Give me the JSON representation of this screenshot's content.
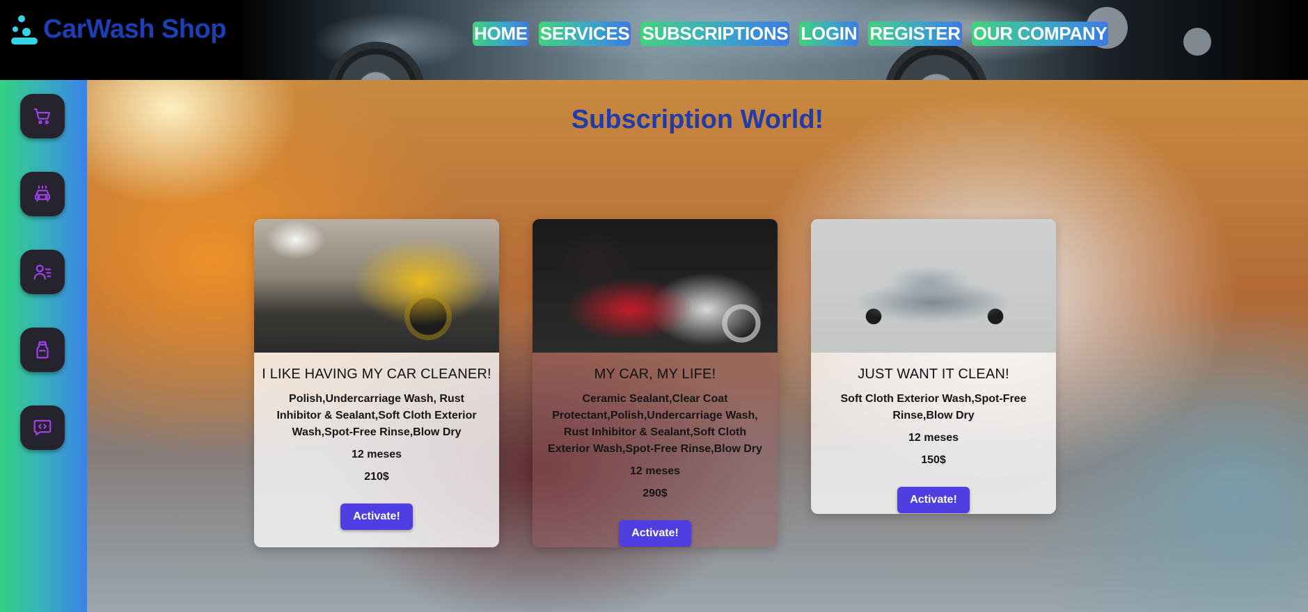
{
  "header": {
    "logo_text": "CarWash Shop",
    "nav": [
      {
        "label": "HOME"
      },
      {
        "label": "SERVICES"
      },
      {
        "label": "SUBSCRIPTIONS"
      },
      {
        "label": "LOGIN"
      },
      {
        "label": "REGISTER"
      },
      {
        "label": "OUR COMPANY"
      }
    ]
  },
  "sidebar": {
    "items": [
      {
        "icon": "cart-icon"
      },
      {
        "icon": "car-wash-icon"
      },
      {
        "icon": "user-list-icon"
      },
      {
        "icon": "spray-bottle-icon"
      },
      {
        "icon": "chat-code-icon"
      }
    ],
    "accent": "#a13fe8"
  },
  "main": {
    "title": "Subscription World!",
    "cards": [
      {
        "image": "yellow-car-wash-image",
        "title": "I LIKE HAVING MY CAR CLEANER!",
        "description": "Polish,Undercarriage Wash, Rust Inhibitor & Sealant,Soft Cloth Exterior Wash,Spot-Free Rinse,Blow Dry",
        "duration": "12 meses",
        "price": "210$",
        "button": "Activate!"
      },
      {
        "image": "red-car-foam-image",
        "title": "MY CAR, MY LIFE!",
        "description": "Ceramic Sealant,Clear Coat Protectant,Polish,Undercarriage Wash, Rust Inhibitor & Sealant,Soft Cloth Exterior Wash,Spot-Free Rinse,Blow Dry",
        "duration": "12 meses",
        "price": "290$",
        "button": "Activate!"
      },
      {
        "image": "rusty-old-car-image",
        "title": "JUST WANT IT CLEAN!",
        "description": "Soft Cloth Exterior Wash,Spot-Free Rinse,Blow Dry",
        "duration": "12 meses",
        "price": "150$",
        "button": "Activate!"
      }
    ]
  },
  "colors": {
    "brand_blue": "#1f3ca8",
    "button": "#4f3fe3",
    "nav_gradient_start": "#3fd479",
    "nav_gradient_end": "#3b7ae6"
  }
}
